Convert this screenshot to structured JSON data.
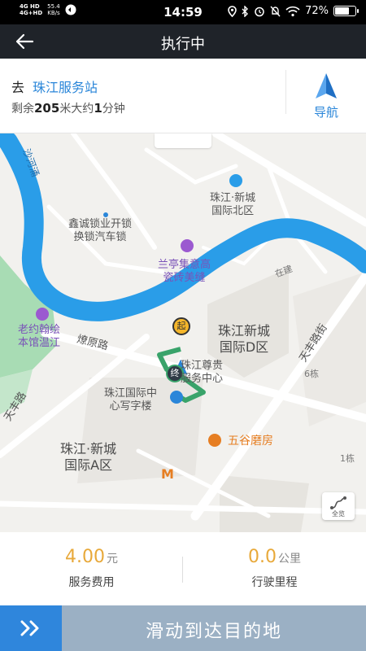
{
  "status_bar": {
    "network_1": "4G HD",
    "network_2": "4G+HD",
    "speed": "55.4",
    "speed_unit": "KB/s",
    "time": "14:59",
    "battery": "72%",
    "battery_level": 0.72
  },
  "header": {
    "title": "执行中"
  },
  "destination": {
    "prefix": "去",
    "name": "珠江服务站",
    "remain_prefix": "剩余",
    "distance": "205",
    "distance_unit": "米大约",
    "minutes": "1",
    "minutes_unit": "分钟",
    "nav_label": "导航"
  },
  "map": {
    "labels": {
      "river": "沙河涌",
      "north": "珠江·新城\n国际北区",
      "locksmith": "鑫诚锁业开锁\n换锁汽车锁",
      "shop1": "兰亭集意高\n瓷砖美缝",
      "shop2": "老约翰绘\n本馆温江",
      "road1": "燎原路",
      "d_zone": "珠江新城\n国际D区",
      "service": "珠江尊贵\n服务中心",
      "office": "珠江国际中\n心写字楼",
      "a_zone": "珠江·新城\n国际A区",
      "restaurant": "五谷磨房",
      "road2": "天丰路",
      "road3": "天丰路街",
      "road4": "在建",
      "bldg6": "6栋",
      "bldg1": "1栋",
      "start_marker": "起",
      "end_marker": "终",
      "fullview": "全览"
    }
  },
  "stats": {
    "fee_value": "4.00",
    "fee_unit": "元",
    "fee_caption": "服务费用",
    "distance_value": "0.0",
    "distance_unit": "公里",
    "distance_caption": "行驶里程"
  },
  "slider": {
    "label": "滑动到达目的地"
  }
}
